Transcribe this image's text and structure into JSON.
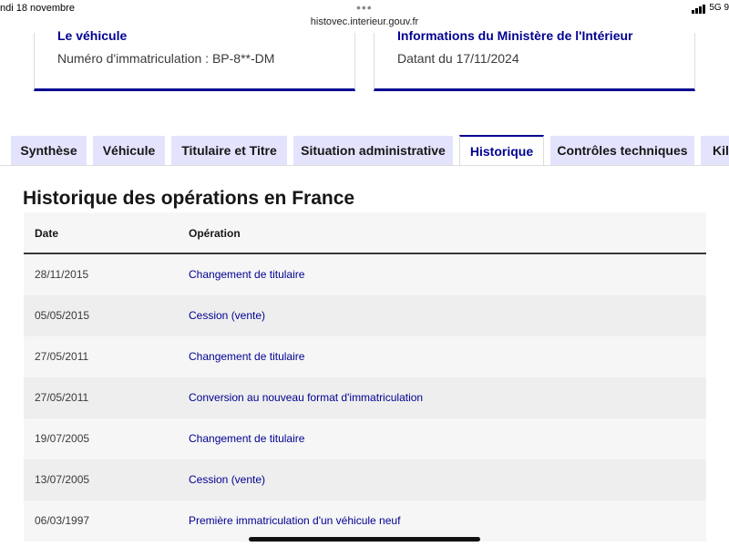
{
  "status_bar": {
    "time": "ndi 18 novembre",
    "url": "histovec.interieur.gouv.fr",
    "network": "5G",
    "battery": "9"
  },
  "cards": [
    {
      "title": "Le véhicule",
      "value": "Numéro d'immatriculation : BP-8**-DM"
    },
    {
      "title": "Informations du Ministère de l'Intérieur",
      "value": "Datant du 17/11/2024"
    }
  ],
  "tabs": [
    {
      "label": "Synthèse",
      "active": false
    },
    {
      "label": "Véhicule",
      "active": false
    },
    {
      "label": "Titulaire et Titre",
      "active": false
    },
    {
      "label": "Situation administrative",
      "active": false
    },
    {
      "label": "Historique",
      "active": true
    },
    {
      "label": "Contrôles techniques",
      "active": false
    },
    {
      "label": "Kilo",
      "active": false
    }
  ],
  "section": {
    "title": "Historique des opérations en France"
  },
  "table": {
    "headers": [
      "Date",
      "Opération"
    ],
    "rows": [
      {
        "date": "28/11/2015",
        "operation": "Changement de titulaire"
      },
      {
        "date": "05/05/2015",
        "operation": "Cession (vente)"
      },
      {
        "date": "27/05/2011",
        "operation": "Changement de titulaire"
      },
      {
        "date": "27/05/2011",
        "operation": "Conversion au nouveau format d'immatriculation"
      },
      {
        "date": "19/07/2005",
        "operation": "Changement de titulaire"
      },
      {
        "date": "13/07/2005",
        "operation": "Cession (vente)"
      },
      {
        "date": "06/03/1997",
        "operation": "Première immatriculation d'un véhicule neuf"
      }
    ]
  },
  "colors": {
    "accent": "#000091",
    "tab_inactive_bg": "#e3e3fd",
    "row_alt": "#eeeeee",
    "row_base": "#f6f6f6"
  }
}
